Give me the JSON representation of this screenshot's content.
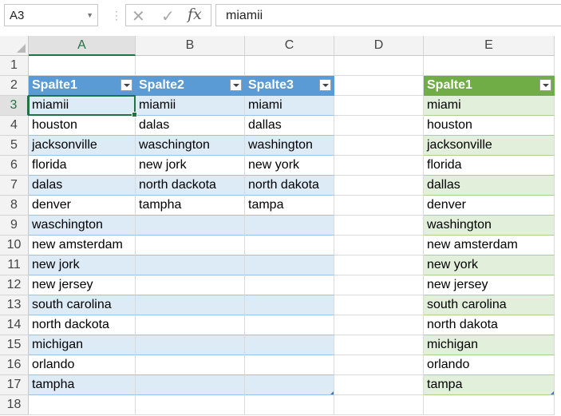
{
  "formula_bar": {
    "name_box": "A3",
    "formula": "miamii",
    "fx_label": "fx"
  },
  "columns": [
    "A",
    "B",
    "C",
    "D",
    "E"
  ],
  "rows": [
    "1",
    "2",
    "3",
    "4",
    "5",
    "6",
    "7",
    "8",
    "9",
    "10",
    "11",
    "12",
    "13",
    "14",
    "15",
    "16",
    "17",
    "18"
  ],
  "table1": {
    "headers": [
      "Spalte1",
      "Spalte2",
      "Spalte3"
    ],
    "col_a": [
      "miamii",
      "houston",
      "jacksonville",
      "florida",
      "dalas",
      "denver",
      "waschington",
      "new amsterdam",
      "new jork",
      "new jersey",
      "south carolina",
      "north dackota",
      "michigan",
      "orlando",
      "tampha"
    ],
    "col_b": [
      "miamii",
      "dalas",
      "waschington",
      "new jork",
      "north dackota",
      "tampha"
    ],
    "col_c": [
      "miami",
      "dallas",
      "washington",
      "new york",
      "north dakota",
      "tampa"
    ]
  },
  "table2": {
    "header": "Spalte1",
    "col_e": [
      "miami",
      "houston",
      "jacksonville",
      "florida",
      "dallas",
      "denver",
      "washington",
      "new amsterdam",
      "new york",
      "new jersey",
      "south carolina",
      "north dakota",
      "michigan",
      "orlando",
      "tampa"
    ]
  },
  "colors": {
    "table1_header": "#5b9bd5",
    "table1_band": "#ddebf7",
    "table2_header": "#70ad47",
    "table2_band": "#e2efda",
    "selection": "#217346"
  }
}
